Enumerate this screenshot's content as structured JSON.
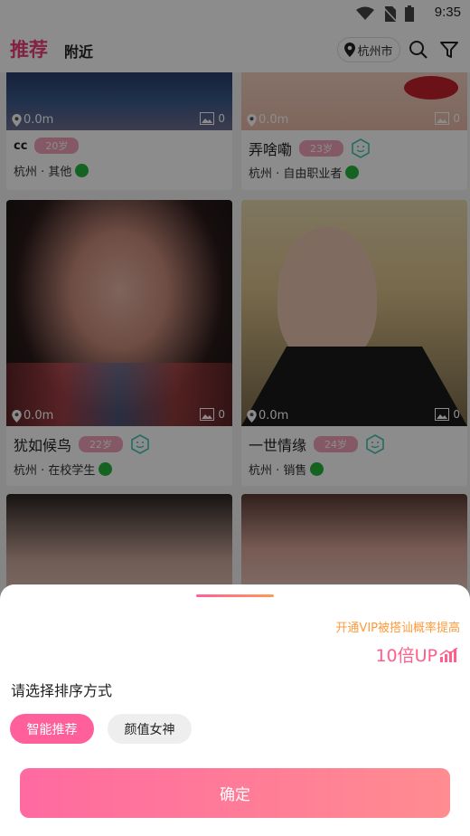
{
  "status_bar": {
    "time": "9:35"
  },
  "header": {
    "tab_recommend": "推荐",
    "tab_nearby": "附近",
    "city": "杭州市"
  },
  "cards": [
    {
      "name": "cc",
      "age": "20岁",
      "city_job": "杭州 · 其他",
      "distance": "0.0m",
      "photo_count": "0",
      "verified": false
    },
    {
      "name": "弄啥嘞",
      "age": "23岁",
      "city_job": "杭州 · 自由职业者",
      "distance": "0.0m",
      "photo_count": "0",
      "verified": true
    },
    {
      "name": "犹如候鸟",
      "age": "22岁",
      "city_job": "杭州 · 在校学生",
      "distance": "0.0m",
      "photo_count": "0",
      "verified": true
    },
    {
      "name": "一世情缘",
      "age": "24岁",
      "city_job": "杭州 · 销售",
      "distance": "0.0m",
      "photo_count": "0",
      "verified": true
    }
  ],
  "sheet": {
    "vip_promo": "开通VIP被搭讪概率提高",
    "vip_up": "10倍UP",
    "title": "请选择排序方式",
    "option_smart": "智能推荐",
    "option_beauty": "颜值女神",
    "confirm": "确定"
  },
  "colors": {
    "accent": "#ee3d7a",
    "vip": "#ff9a3c",
    "button": "#ff6aa0"
  }
}
